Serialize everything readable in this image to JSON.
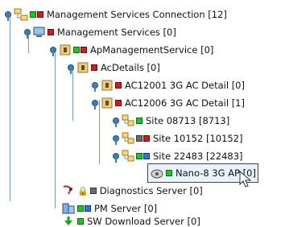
{
  "tree": {
    "nodes": [
      {
        "label": "Management Services Connection [12]"
      },
      {
        "label": "Management Services [0]"
      },
      {
        "label": "ApManagementService [0]"
      },
      {
        "label": "AcDetails [0]"
      },
      {
        "label": "AC12001 3G AC Detail [0]"
      },
      {
        "label": "AC12006 3G AC Detail [1]"
      },
      {
        "label": "Site 08713 [8713]"
      },
      {
        "label": "Site 10152 [10152]"
      },
      {
        "label": "Site 22483 [22483]"
      },
      {
        "label": "Nano-8 3G AP [0]"
      },
      {
        "label": "Diagnostics Server [0]"
      },
      {
        "label": "PM Server [0]"
      },
      {
        "label": "SW Download Server [0]"
      }
    ]
  },
  "colors": {
    "status_green": "#24c12b",
    "status_red": "#d41c1c",
    "status_blue": "#2f74d4",
    "connector": "#7a9ab0"
  }
}
